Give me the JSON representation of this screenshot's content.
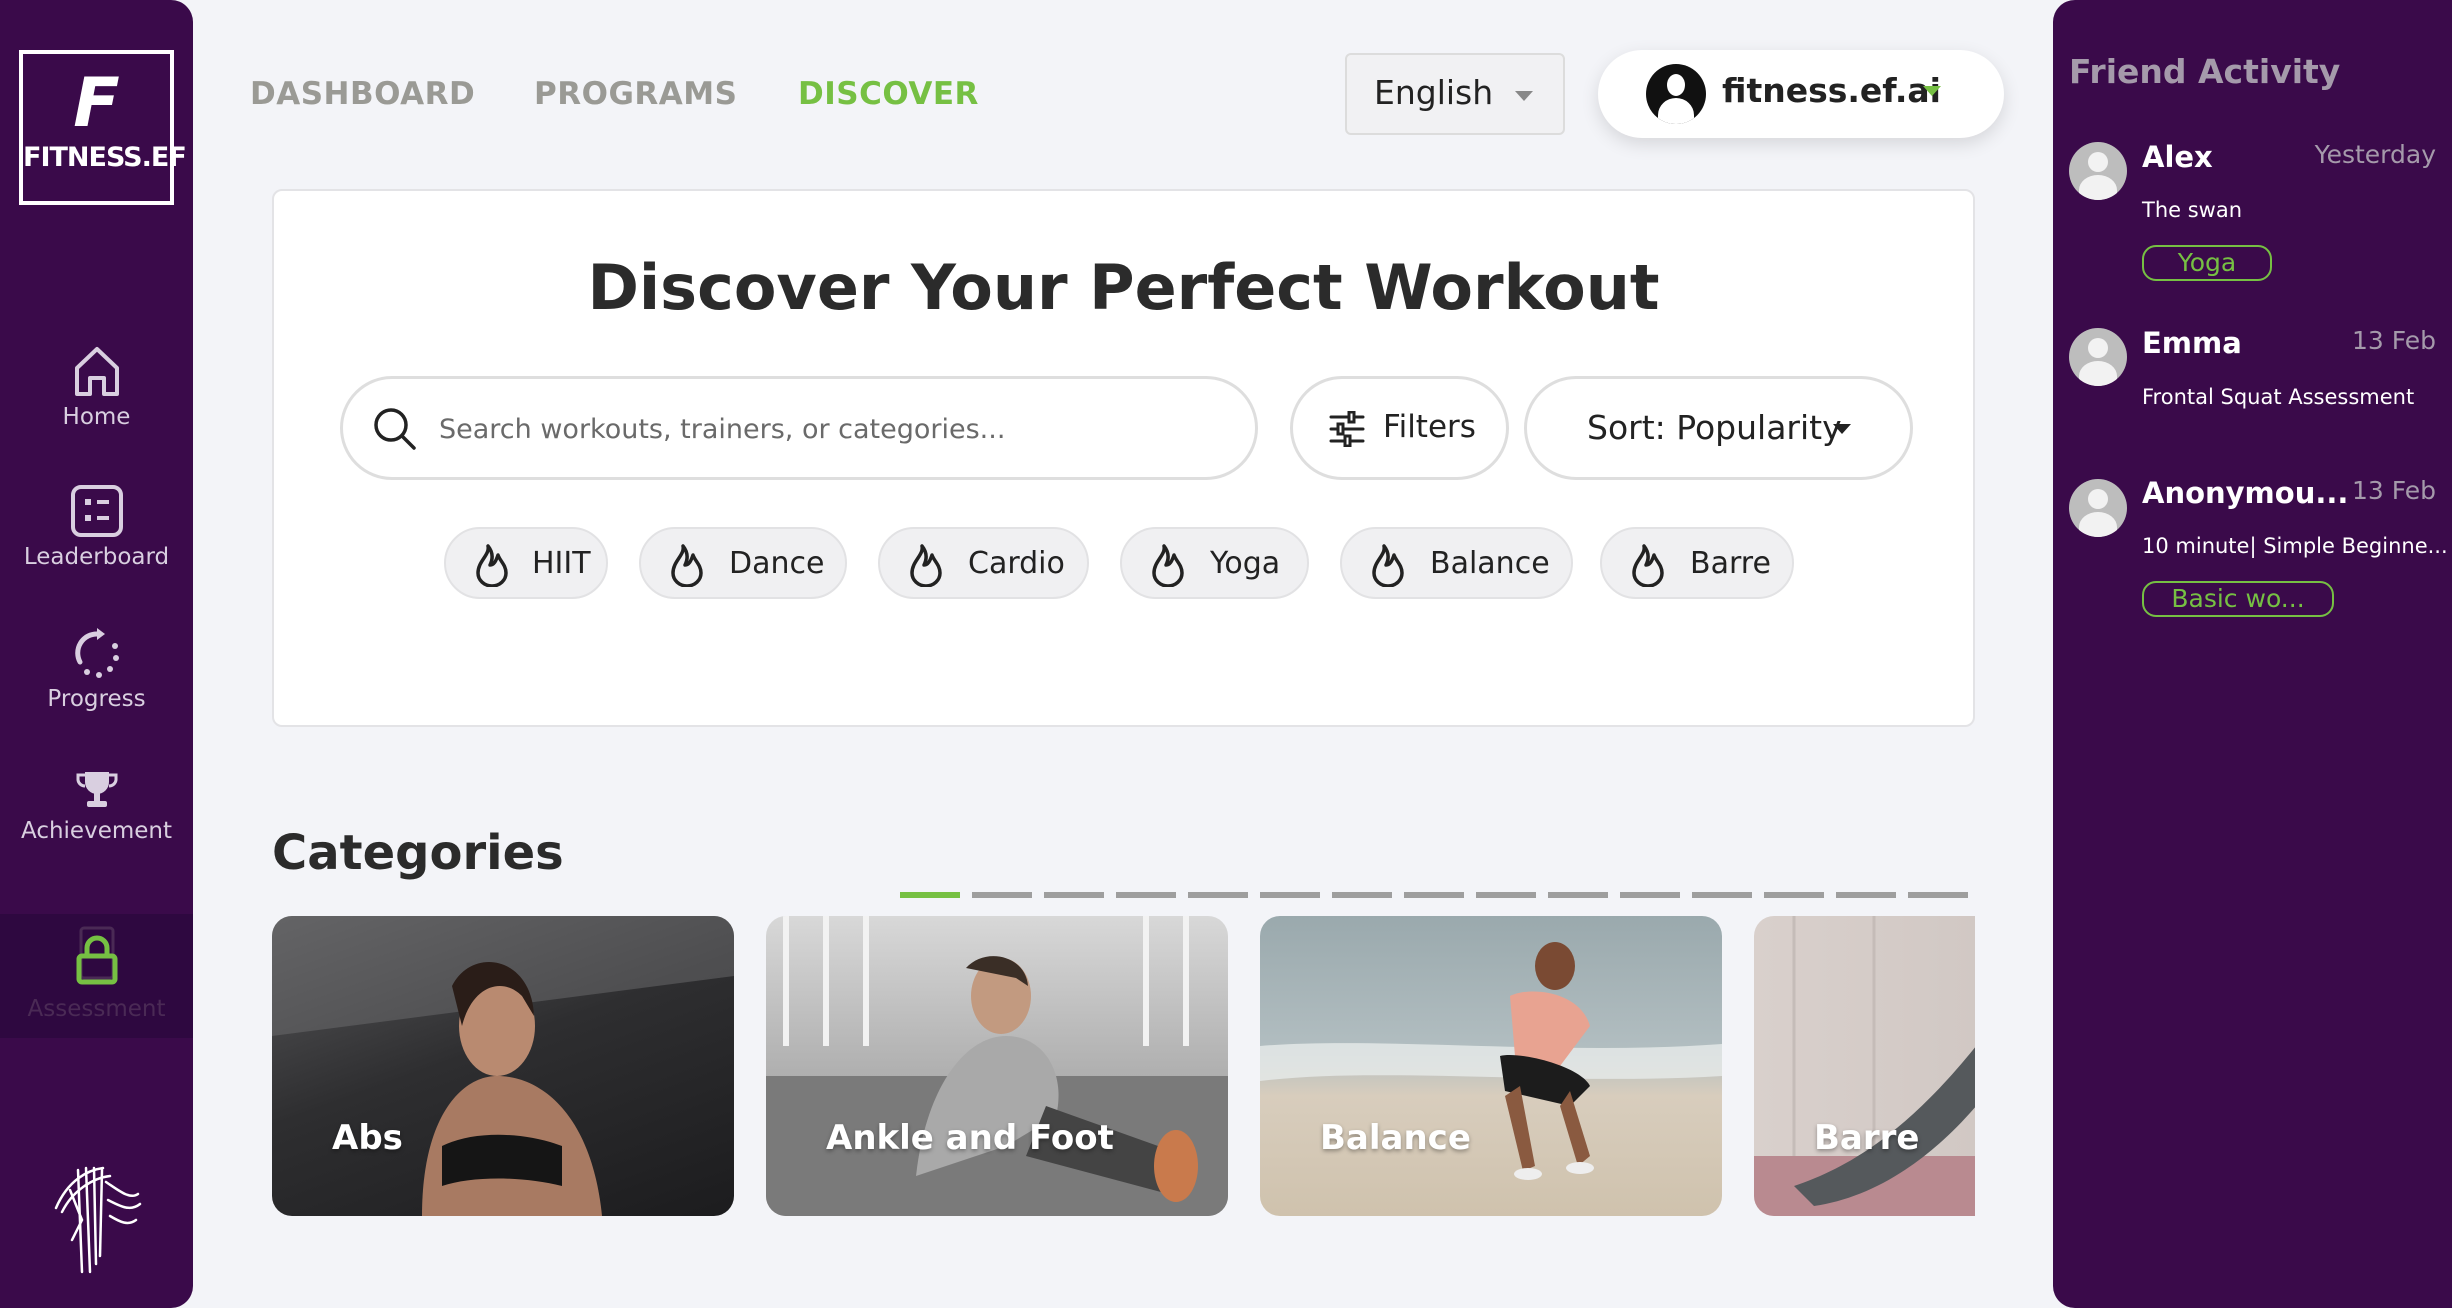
{
  "brand": {
    "logo_letter": "F",
    "logo_text": "FITNESS.EF"
  },
  "sidebar": {
    "items": [
      {
        "label": "Home",
        "icon": "home-icon"
      },
      {
        "label": "Leaderboard",
        "icon": "leaderboard-icon"
      },
      {
        "label": "Progress",
        "icon": "progress-icon"
      },
      {
        "label": "Achievement",
        "icon": "trophy-icon"
      },
      {
        "label": "Assessment",
        "icon": "lock-icon",
        "locked": true
      }
    ]
  },
  "topnav": {
    "tabs": [
      {
        "label": "DASHBOARD",
        "active": false
      },
      {
        "label": "PROGRAMS",
        "active": false
      },
      {
        "label": "DISCOVER",
        "active": true
      }
    ],
    "language": "English",
    "account_name": "fitness.ef.ai"
  },
  "discover": {
    "title": "Discover Your Perfect Workout",
    "search_placeholder": "Search workouts, trainers, or categories...",
    "filters_label": "Filters",
    "sort_label": "Sort: Popularity",
    "tags": [
      "HIIT",
      "Dance",
      "Cardio",
      "Yoga",
      "Balance",
      "Barre"
    ]
  },
  "categories": {
    "title": "Categories",
    "page_count": 15,
    "active_page": 1,
    "cards": [
      "Abs",
      "Ankle and Foot",
      "Balance",
      "Barre"
    ]
  },
  "friend_activity": {
    "title": "Friend Activity",
    "items": [
      {
        "name": "Alex",
        "time": "Yesterday",
        "desc": "The swan",
        "tag": "Yoga"
      },
      {
        "name": "Emma",
        "time": "13 Feb",
        "desc": "Frontal Squat Assessment",
        "tag": ""
      },
      {
        "name": "Anonymou...",
        "time": "13 Feb",
        "desc": "10 minute| Simple Beginne...",
        "tag": "Basic wo..."
      }
    ]
  },
  "colors": {
    "sidebar": "#3a0a4a",
    "accent": "#76c043",
    "background": "#f3f4f8"
  }
}
